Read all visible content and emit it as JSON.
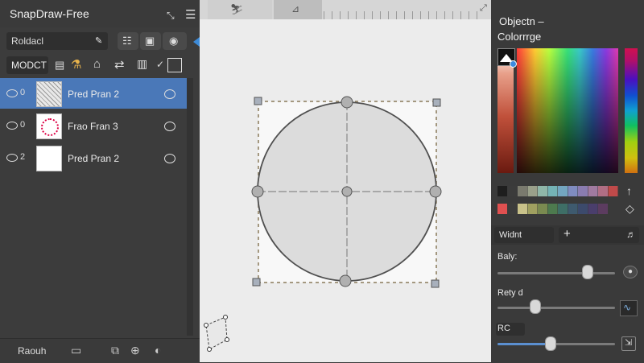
{
  "app": {
    "title": "SnapDraw-Free"
  },
  "left_panel": {
    "search_value": "Roldacl",
    "mode_label": "MODCT",
    "layers": [
      {
        "num": "0",
        "name": "Pred Pran 2",
        "selected": true
      },
      {
        "num": "0",
        "name": "Frao Fran 3",
        "selected": false
      },
      {
        "num": "2",
        "name": "Pred Pran 2",
        "selected": false
      }
    ],
    "footer_label": "Raouh"
  },
  "right_panel": {
    "title_line1": "Objectn –",
    "title_line2": "Colorrrge",
    "width_label": "Widnt",
    "width_plus": "+",
    "slider1_label": "Baly:",
    "slider2_label": "Rety d",
    "slider3_label": "RC",
    "slider_values": {
      "baly": 0.78,
      "rety": 0.3,
      "rc": 0.44
    },
    "palette_row1": [
      "#1e1e1e",
      "#3b3b3b",
      "#7a7a6e",
      "#9aa08a",
      "#8fb6a8",
      "#74b3b5",
      "#73a6c0",
      "#7f8cc0",
      "#8a7cb0",
      "#a07aa0",
      "#b06e84",
      "#c04a4a"
    ],
    "palette_row2": [
      "#e05050",
      "#3c3c3c",
      "#c9c28a",
      "#a0a060",
      "#7a8a50",
      "#4d7a4e",
      "#3e6e66",
      "#3e5a6e",
      "#3c4a6c",
      "#4a3e6c",
      "#5c3c60"
    ]
  },
  "colors": {
    "accent": "#4a78b8",
    "canvas_bg": "#ececec",
    "circle_fill": "#dcdcdc"
  }
}
